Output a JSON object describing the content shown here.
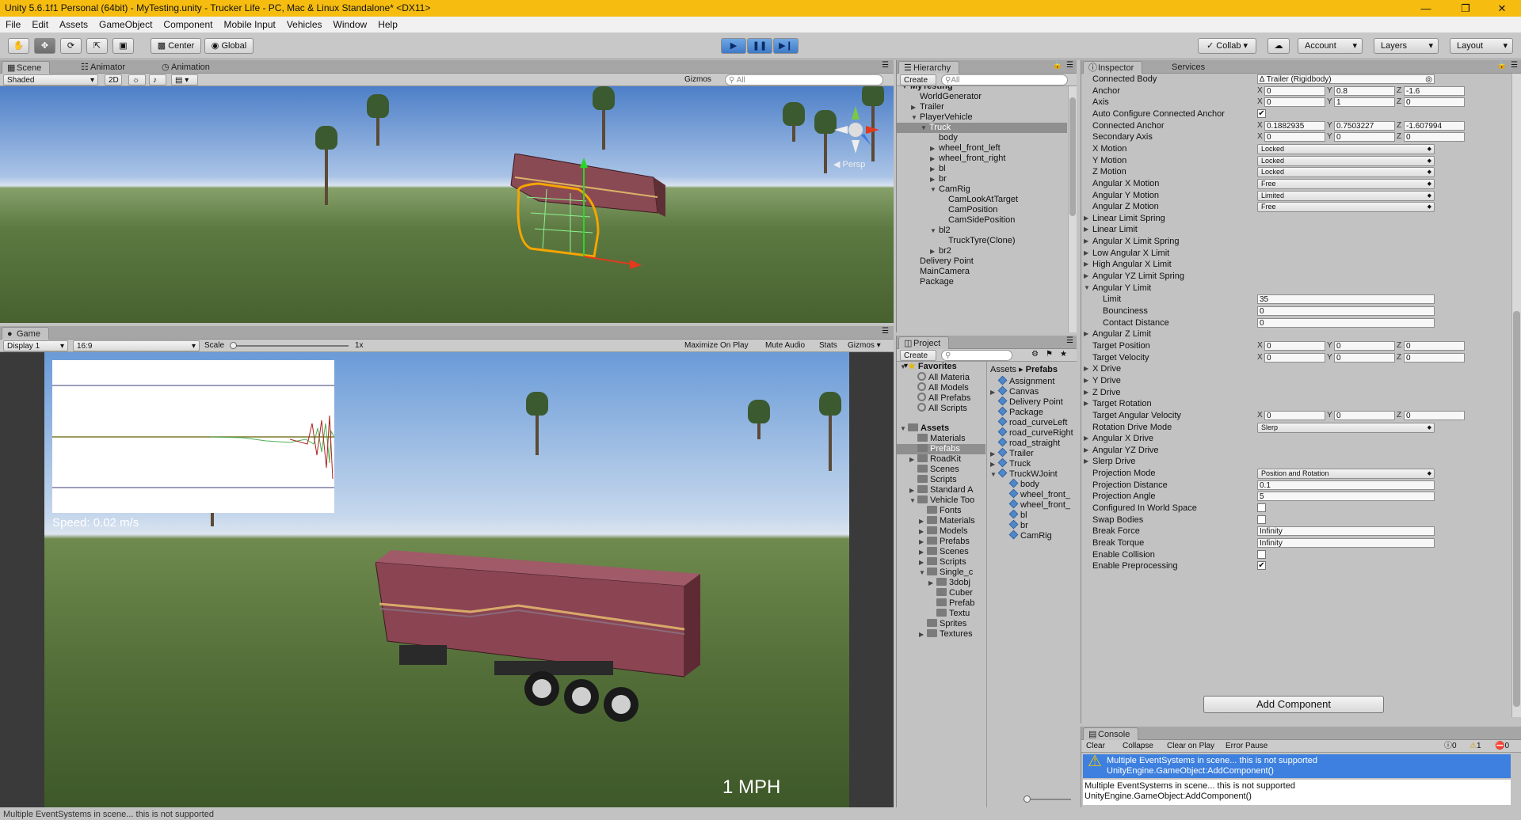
{
  "window": {
    "title": "Unity 5.6.1f1 Personal (64bit) - MyTesting.unity - Trucker Life - PC, Mac & Linux Standalone* <DX11>"
  },
  "menu": [
    "File",
    "Edit",
    "Assets",
    "GameObject",
    "Component",
    "Mobile Input",
    "Vehicles",
    "Window",
    "Help"
  ],
  "toolbar": {
    "center": "Center",
    "global": "Global",
    "collab": "Collab",
    "account": "Account",
    "layers": "Layers",
    "layout": "Layout"
  },
  "scene": {
    "tab_scene": "Scene",
    "tab_animator": "Animator",
    "tab_animation": "Animation",
    "shaded": "Shaded",
    "mode2d": "2D",
    "gizmos": "Gizmos",
    "search_placeholder": "All",
    "persp": "Persp"
  },
  "game": {
    "tab": "Game",
    "display": "Display 1",
    "aspect": "16:9",
    "scale_label": "Scale",
    "scale_value": "1x",
    "maximize": "Maximize On Play",
    "mute": "Mute Audio",
    "stats": "Stats",
    "gizmos": "Gizmos",
    "speed": "Speed: 0.02 m/s",
    "mph": "1 MPH"
  },
  "hierarchy": {
    "tab": "Hierarchy",
    "create": "Create",
    "search_placeholder": "All",
    "items": [
      {
        "label": "MyTesting",
        "indent": 0,
        "fold": "open"
      },
      {
        "label": "WorldGenerator",
        "indent": 1,
        "fold": ""
      },
      {
        "label": "Trailer",
        "indent": 1,
        "fold": "closed"
      },
      {
        "label": "PlayerVehicle",
        "indent": 1,
        "fold": "open"
      },
      {
        "label": "Truck",
        "indent": 2,
        "fold": "open",
        "selected": true
      },
      {
        "label": "body",
        "indent": 3,
        "fold": ""
      },
      {
        "label": "wheel_front_left",
        "indent": 3,
        "fold": "closed"
      },
      {
        "label": "wheel_front_right",
        "indent": 3,
        "fold": "closed"
      },
      {
        "label": "bl",
        "indent": 3,
        "fold": "closed"
      },
      {
        "label": "br",
        "indent": 3,
        "fold": "closed"
      },
      {
        "label": "CamRig",
        "indent": 3,
        "fold": "open"
      },
      {
        "label": "CamLookAtTarget",
        "indent": 4,
        "fold": ""
      },
      {
        "label": "CamPosition",
        "indent": 4,
        "fold": ""
      },
      {
        "label": "CamSidePosition",
        "indent": 4,
        "fold": ""
      },
      {
        "label": "bl2",
        "indent": 3,
        "fold": "open"
      },
      {
        "label": "TruckTyre(Clone)",
        "indent": 4,
        "fold": ""
      },
      {
        "label": "br2",
        "indent": 3,
        "fold": "closed"
      },
      {
        "label": "Delivery Point",
        "indent": 1,
        "fold": ""
      },
      {
        "label": "MainCamera",
        "indent": 1,
        "fold": ""
      },
      {
        "label": "Package",
        "indent": 1,
        "fold": ""
      }
    ]
  },
  "project": {
    "tab": "Project",
    "create": "Create",
    "breadcrumb_root": "Assets",
    "breadcrumb_leaf": "Prefabs",
    "left": [
      {
        "label": "Favorites",
        "indent": 0,
        "type": "star",
        "fold": "open",
        "bold": true
      },
      {
        "label": "All Materia",
        "indent": 1,
        "type": "mag"
      },
      {
        "label": "All Models",
        "indent": 1,
        "type": "mag"
      },
      {
        "label": "All Prefabs",
        "indent": 1,
        "type": "mag"
      },
      {
        "label": "All Scripts",
        "indent": 1,
        "type": "mag"
      },
      {
        "label": "",
        "indent": 0,
        "type": "gap"
      },
      {
        "label": "Assets",
        "indent": 0,
        "type": "folder",
        "fold": "open",
        "bold": true
      },
      {
        "label": "Materials",
        "indent": 1,
        "type": "folder"
      },
      {
        "label": "Prefabs",
        "indent": 1,
        "type": "folder",
        "selected": true
      },
      {
        "label": "RoadKit",
        "indent": 1,
        "type": "folder",
        "fold": "closed"
      },
      {
        "label": "Scenes",
        "indent": 1,
        "type": "folder"
      },
      {
        "label": "Scripts",
        "indent": 1,
        "type": "folder"
      },
      {
        "label": "Standard A",
        "indent": 1,
        "type": "folder",
        "fold": "closed"
      },
      {
        "label": "Vehicle Too",
        "indent": 1,
        "type": "folder",
        "fold": "open"
      },
      {
        "label": "Fonts",
        "indent": 2,
        "type": "folder"
      },
      {
        "label": "Materials",
        "indent": 2,
        "type": "folder",
        "fold": "closed"
      },
      {
        "label": "Models",
        "indent": 2,
        "type": "folder",
        "fold": "closed"
      },
      {
        "label": "Prefabs",
        "indent": 2,
        "type": "folder",
        "fold": "closed"
      },
      {
        "label": "Scenes",
        "indent": 2,
        "type": "folder",
        "fold": "closed"
      },
      {
        "label": "Scripts",
        "indent": 2,
        "type": "folder",
        "fold": "closed"
      },
      {
        "label": "Single_c",
        "indent": 2,
        "type": "folder",
        "fold": "open"
      },
      {
        "label": "3dobj",
        "indent": 3,
        "type": "folder",
        "fold": "closed"
      },
      {
        "label": "Cuber",
        "indent": 3,
        "type": "folder"
      },
      {
        "label": "Prefab",
        "indent": 3,
        "type": "folder"
      },
      {
        "label": "Textu",
        "indent": 3,
        "type": "folder"
      },
      {
        "label": "Sprites",
        "indent": 2,
        "type": "folder"
      },
      {
        "label": "Textures",
        "indent": 2,
        "type": "folder",
        "fold": "closed"
      }
    ],
    "right": [
      {
        "label": "Assignment",
        "indent": 0,
        "fold": ""
      },
      {
        "label": "Canvas",
        "indent": 0,
        "fold": "closed"
      },
      {
        "label": "Delivery Point",
        "indent": 0,
        "fold": ""
      },
      {
        "label": "Package",
        "indent": 0,
        "fold": ""
      },
      {
        "label": "road_curveLeft",
        "indent": 0,
        "fold": ""
      },
      {
        "label": "road_curveRight",
        "indent": 0,
        "fold": ""
      },
      {
        "label": "road_straight",
        "indent": 0,
        "fold": ""
      },
      {
        "label": "Trailer",
        "indent": 0,
        "fold": "closed"
      },
      {
        "label": "Truck",
        "indent": 0,
        "fold": "closed"
      },
      {
        "label": "TruckWJoint",
        "indent": 0,
        "fold": "open"
      },
      {
        "label": "body",
        "indent": 1,
        "fold": ""
      },
      {
        "label": "wheel_front_",
        "indent": 1,
        "fold": ""
      },
      {
        "label": "wheel_front_",
        "indent": 1,
        "fold": ""
      },
      {
        "label": "bl",
        "indent": 1,
        "fold": ""
      },
      {
        "label": "br",
        "indent": 1,
        "fold": ""
      },
      {
        "label": "CamRig",
        "indent": 1,
        "fold": ""
      }
    ]
  },
  "inspector": {
    "tab": "Inspector",
    "tab2": "Services",
    "rows": [
      {
        "label": "Connected Body",
        "kind": "object",
        "value": "Trailer (Rigidbody)"
      },
      {
        "label": "Anchor",
        "kind": "xyz",
        "x": "0",
        "y": "0.8",
        "z": "-1.6"
      },
      {
        "label": "Axis",
        "kind": "xyz",
        "x": "0",
        "y": "1",
        "z": "0"
      },
      {
        "label": "Auto Configure Connected Anchor",
        "kind": "check",
        "value": true
      },
      {
        "label": "Connected Anchor",
        "kind": "xyz",
        "x": "0.1882935",
        "y": "0.7503227",
        "z": "-1.607994"
      },
      {
        "label": "Secondary Axis",
        "kind": "xyz",
        "x": "0",
        "y": "0",
        "z": "0"
      },
      {
        "label": "X Motion",
        "kind": "popup",
        "value": "Locked"
      },
      {
        "label": "Y Motion",
        "kind": "popup",
        "value": "Locked"
      },
      {
        "label": "Z Motion",
        "kind": "popup",
        "value": "Locked"
      },
      {
        "label": "Angular X Motion",
        "kind": "popup",
        "value": "Free"
      },
      {
        "label": "Angular Y Motion",
        "kind": "popup",
        "value": "Limited"
      },
      {
        "label": "Angular Z Motion",
        "kind": "popup",
        "value": "Free"
      },
      {
        "label": "Linear Limit Spring",
        "kind": "fold"
      },
      {
        "label": "Linear Limit",
        "kind": "fold"
      },
      {
        "label": "Angular X Limit Spring",
        "kind": "fold"
      },
      {
        "label": "Low Angular X Limit",
        "kind": "fold"
      },
      {
        "label": "High Angular X Limit",
        "kind": "fold"
      },
      {
        "label": "Angular YZ Limit Spring",
        "kind": "fold"
      },
      {
        "label": "Angular Y Limit",
        "kind": "foldopen"
      },
      {
        "label": "Limit",
        "kind": "field",
        "value": "35",
        "sub": true
      },
      {
        "label": "Bounciness",
        "kind": "field",
        "value": "0",
        "sub": true
      },
      {
        "label": "Contact Distance",
        "kind": "field",
        "value": "0",
        "sub": true
      },
      {
        "label": "Angular Z Limit",
        "kind": "fold"
      },
      {
        "label": "Target Position",
        "kind": "xyz",
        "x": "0",
        "y": "0",
        "z": "0"
      },
      {
        "label": "Target Velocity",
        "kind": "xyz",
        "x": "0",
        "y": "0",
        "z": "0"
      },
      {
        "label": "X Drive",
        "kind": "fold"
      },
      {
        "label": "Y Drive",
        "kind": "fold"
      },
      {
        "label": "Z Drive",
        "kind": "fold"
      },
      {
        "label": "Target Rotation",
        "kind": "fold"
      },
      {
        "label": "Target Angular Velocity",
        "kind": "xyz",
        "x": "0",
        "y": "0",
        "z": "0"
      },
      {
        "label": "Rotation Drive Mode",
        "kind": "popup",
        "value": "Slerp"
      },
      {
        "label": "Angular X Drive",
        "kind": "fold"
      },
      {
        "label": "Angular YZ Drive",
        "kind": "fold"
      },
      {
        "label": "Slerp Drive",
        "kind": "fold"
      },
      {
        "label": "Projection Mode",
        "kind": "popup",
        "value": "Position and Rotation"
      },
      {
        "label": "Projection Distance",
        "kind": "field",
        "value": "0.1"
      },
      {
        "label": "Projection Angle",
        "kind": "field",
        "value": "5"
      },
      {
        "label": "Configured In World Space",
        "kind": "check",
        "value": false
      },
      {
        "label": "Swap Bodies",
        "kind": "check",
        "value": false
      },
      {
        "label": "Break Force",
        "kind": "field",
        "value": "Infinity"
      },
      {
        "label": "Break Torque",
        "kind": "field",
        "value": "Infinity"
      },
      {
        "label": "Enable Collision",
        "kind": "check",
        "value": false
      },
      {
        "label": "Enable Preprocessing",
        "kind": "check",
        "value": true
      }
    ],
    "add_component": "Add Component"
  },
  "console": {
    "tab": "Console",
    "clear": "Clear",
    "collapse": "Collapse",
    "clear_on_play": "Clear on Play",
    "error_pause": "Error Pause",
    "count_info": "0",
    "count_warn": "1",
    "count_err": "0",
    "entry_line1": "Multiple EventSystems in scene... this is not supported",
    "entry_line2": "UnityEngine.GameObject:AddComponent()",
    "detail_line1": "Multiple EventSystems in scene... this is not supported",
    "detail_line2": "UnityEngine.GameObject:AddComponent()"
  },
  "status": {
    "text": "Multiple EventSystems in scene... this is not supported"
  },
  "colors": {
    "title_bar": "#f6bd10",
    "selection": "#3d80df",
    "play_blue": "#3f7ac7"
  }
}
